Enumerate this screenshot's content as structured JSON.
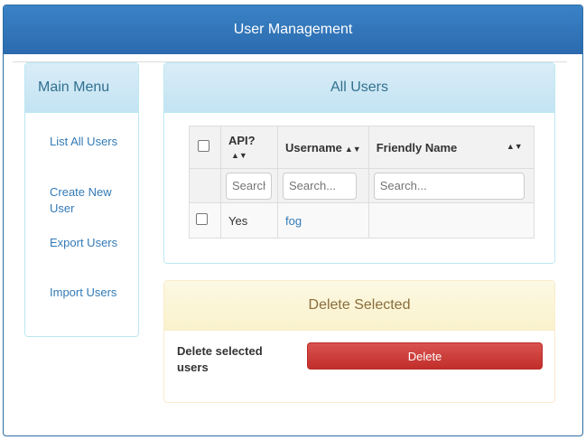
{
  "window": {
    "title": "User Management"
  },
  "menu": {
    "title": "Main Menu",
    "items": [
      {
        "label": "List All Users"
      },
      {
        "label": "Create New User"
      },
      {
        "label": "Export Users"
      },
      {
        "label": "Import Users"
      }
    ]
  },
  "users_panel": {
    "title": "All Users",
    "columns": [
      "API?",
      "Username",
      "Friendly Name"
    ],
    "filters": {
      "api_placeholder": "Search...",
      "username_placeholder": "Search...",
      "friendly_placeholder": "Search..."
    },
    "rows": [
      {
        "api": "Yes",
        "username": "fog",
        "friendly_name": ""
      }
    ]
  },
  "delete_panel": {
    "title": "Delete Selected",
    "label": "Delete selected users",
    "button": "Delete"
  },
  "icons": {
    "sort": "sort-icon",
    "checkbox": "checkbox"
  },
  "colors": {
    "primary": "#2b6aae",
    "info_bg": "#d9edf7",
    "warning_bg": "#fcf8e3",
    "danger": "#d9534f"
  }
}
